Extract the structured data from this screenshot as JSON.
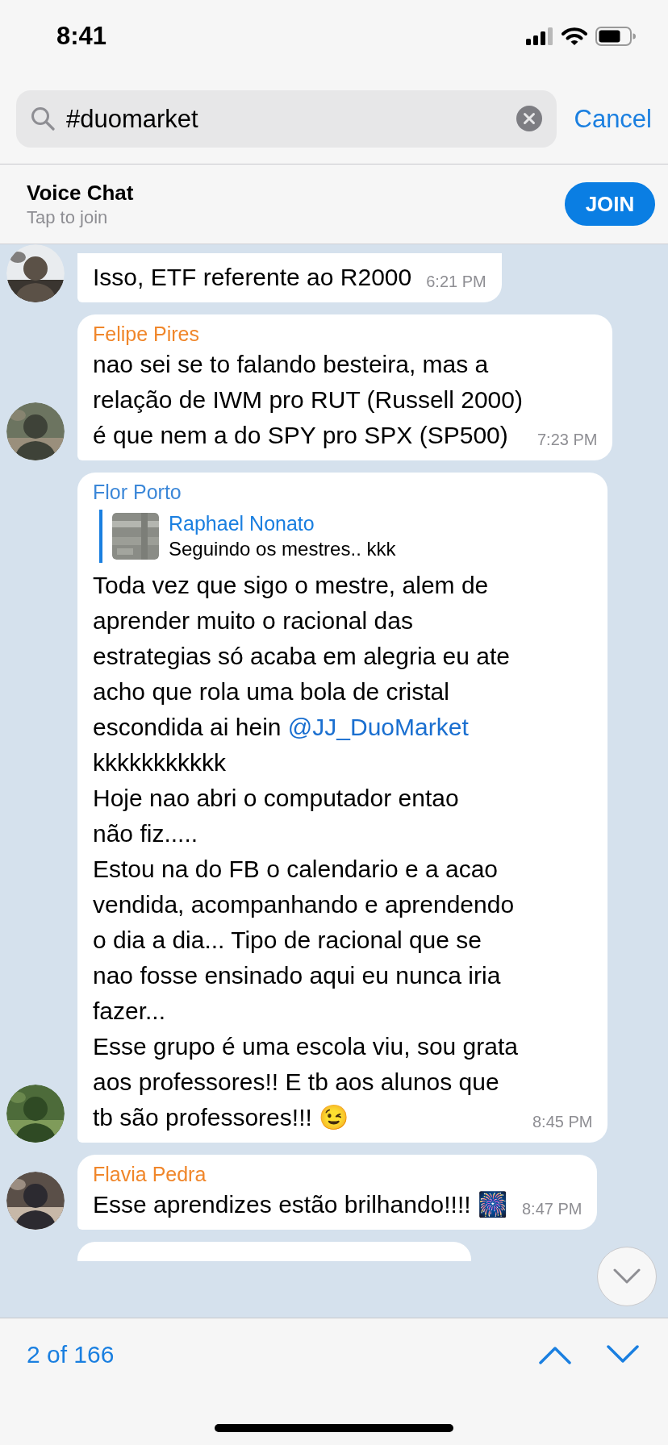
{
  "status_bar": {
    "time": "8:41"
  },
  "search": {
    "value": "#duomarket",
    "cancel": "Cancel"
  },
  "voice_chat": {
    "title": "Voice Chat",
    "subtitle": "Tap to join",
    "button": "JOIN"
  },
  "messages": [
    {
      "kind": "text",
      "parts": [
        {
          "kind": "text",
          "text": "Isso, ETF referente ao R2000"
        }
      ],
      "time": "6:21 PM"
    },
    {
      "kind": "text",
      "sender": "Felipe Pires",
      "color": "#f0862a",
      "parts": [
        {
          "kind": "text",
          "text": "nao sei se to falando besteira, mas a\nrelação de IWM pro RUT (Russell 2000)\né que nem a do SPY pro SPX (SP500)"
        }
      ],
      "time": "7:23 PM"
    },
    {
      "kind": "text",
      "sender": "Flor Porto",
      "color": "#3b87d8",
      "reply": {
        "sender": "Raphael Nonato",
        "text": "Seguindo os mestres.. kkk"
      },
      "parts": [
        {
          "kind": "text",
          "text": "Toda vez que sigo o mestre, alem de\naprender muito o racional das\nestrategias só acaba em alegria eu ate\nacho que rola uma bola de cristal\nescondida ai hein "
        },
        {
          "kind": "mention",
          "text": "@JJ_DuoMarket"
        },
        {
          "kind": "text",
          "text": "\nkkkkkkkkkkk\nHoje nao abri o computador entao\nnão fiz.....\nEstou na do FB o calendario e a acao\nvendida, acompanhando e aprendendo\no dia a dia... Tipo de racional que se\nnao fosse ensinado aqui eu nunca iria\nfazer...\nEsse grupo é uma escola viu, sou grata\naos professores!! E tb aos alunos que\ntb são professores!!! 😉"
        }
      ],
      "time": "8:45 PM"
    },
    {
      "kind": "text",
      "sender": "Flavia Pedra",
      "color": "#f0862a",
      "parts": [
        {
          "kind": "text",
          "text": "Esse aprendizes estão brilhando!!!! 🎆"
        }
      ],
      "time": "8:47 PM"
    },
    {
      "kind": "cut_off"
    }
  ],
  "results": {
    "counter": "2 of 166"
  }
}
